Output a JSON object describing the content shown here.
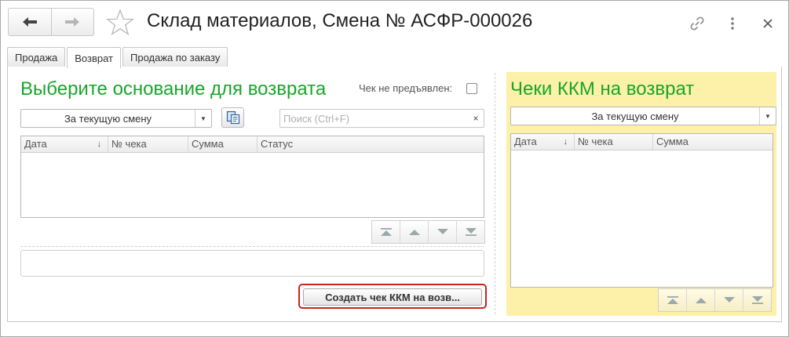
{
  "window": {
    "title": "Склад материалов, Смена № АСФР-000026",
    "icons": [
      "back-arrow-icon",
      "forward-arrow-icon",
      "star-icon",
      "link-icon",
      "more-icon",
      "close-icon"
    ]
  },
  "tabs": [
    {
      "label": "Продажа",
      "active": false
    },
    {
      "label": "Возврат",
      "active": true
    },
    {
      "label": "Продажа по заказу",
      "active": false
    }
  ],
  "left": {
    "heading": "Выберите основание для возврата",
    "checkbox_label": "Чек не предъявлен:",
    "checkbox_checked": false,
    "period_select": "За текущую смену",
    "search_placeholder": "Поиск (Ctrl+F)",
    "clear_symbol": "×",
    "columns": [
      "Дата",
      "№ чека",
      "Сумма",
      "Статус"
    ],
    "sort_indicator": "↓",
    "rows": [],
    "create_button": "Создать чек ККМ на возв..."
  },
  "right": {
    "heading": "Чеки ККМ на возврат",
    "period_select": "За текущую смену",
    "columns": [
      "Дата",
      "№ чека",
      "Сумма"
    ],
    "sort_indicator": "↓",
    "rows": []
  },
  "colors": {
    "heading_green": "#1aa52b",
    "right_panel_bg": "#fdf0a8",
    "highlight_red": "#c8241d"
  }
}
